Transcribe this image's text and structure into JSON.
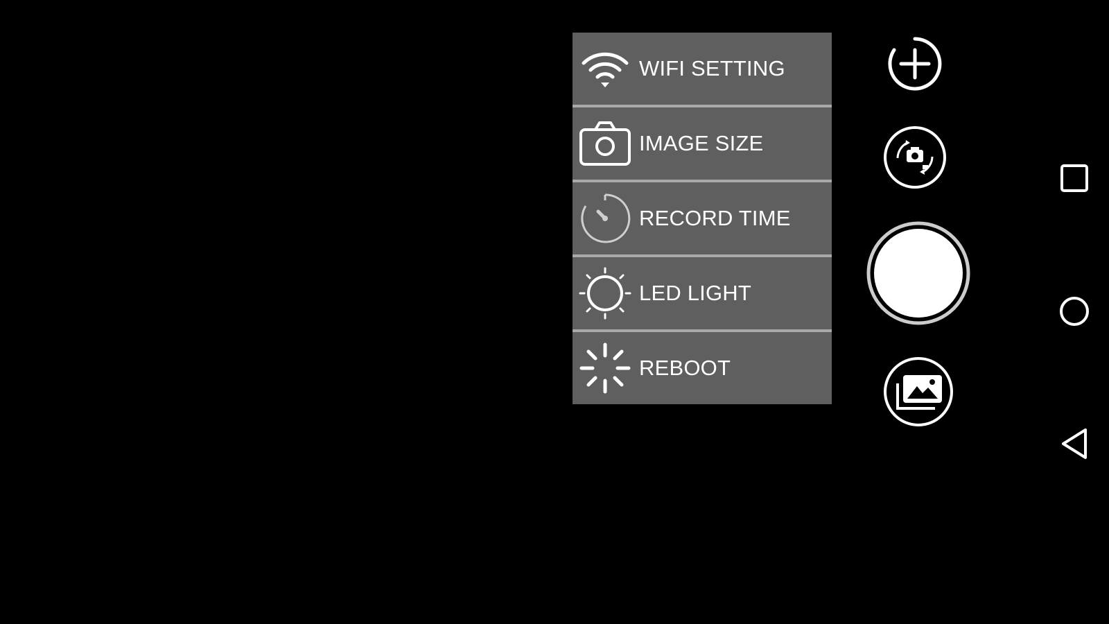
{
  "menu": {
    "items": [
      {
        "label": "WIFI SETTING",
        "icon": "wifi-icon"
      },
      {
        "label": "IMAGE SIZE",
        "icon": "camera-icon"
      },
      {
        "label": "RECORD TIME",
        "icon": "timer-icon"
      },
      {
        "label": "LED LIGHT",
        "icon": "sun-icon"
      },
      {
        "label": "REBOOT",
        "icon": "spinner-icon"
      }
    ]
  },
  "controls": {
    "add": {
      "icon": "plus-icon"
    },
    "switch_camera": {
      "icon": "camera-switch-icon"
    },
    "shutter": {
      "icon": "shutter-icon"
    },
    "gallery": {
      "icon": "gallery-icon"
    }
  },
  "nav": {
    "recents": {
      "icon": "square-icon"
    },
    "home": {
      "icon": "circle-icon"
    },
    "back": {
      "icon": "triangle-back-icon"
    }
  },
  "colors": {
    "menu_bg": "#5f5f5f",
    "menu_separator": "#a9a9a9",
    "text": "#ffffff",
    "background": "#000000"
  }
}
